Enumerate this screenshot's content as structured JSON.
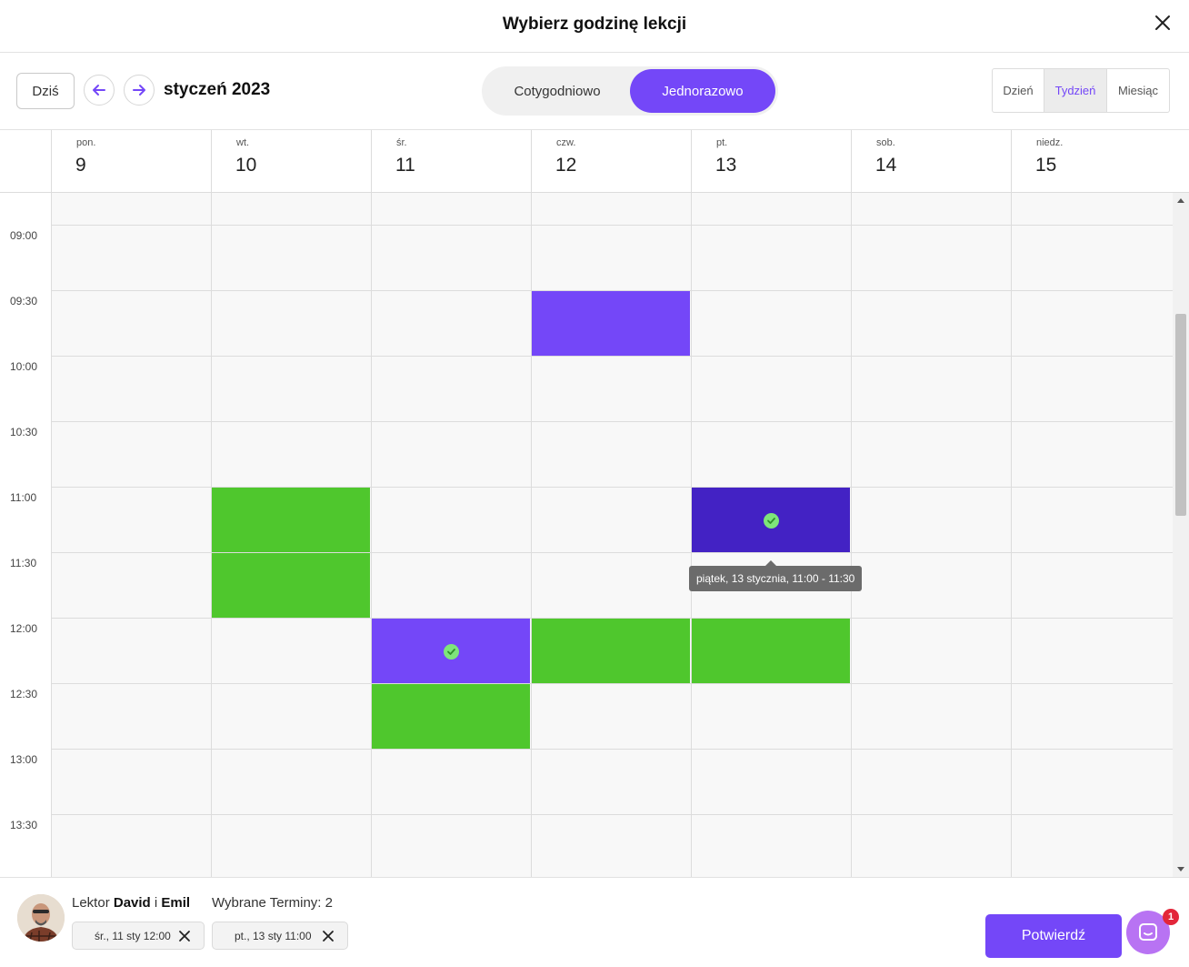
{
  "header": {
    "title": "Wybierz godzinę lekcji",
    "close_icon": "close-icon"
  },
  "toolbar": {
    "today_label": "Dziś",
    "month_label": "styczeń 2023",
    "mode": {
      "weekly": "Cotygodniowo",
      "once": "Jednorazowo",
      "selected": "once"
    },
    "views": {
      "day": "Dzień",
      "week": "Tydzień",
      "month": "Miesiąc",
      "selected": "week"
    }
  },
  "days": [
    {
      "name": "pon.",
      "num": "9"
    },
    {
      "name": "wt.",
      "num": "10"
    },
    {
      "name": "śr.",
      "num": "11"
    },
    {
      "name": "czw.",
      "num": "12"
    },
    {
      "name": "pt.",
      "num": "13"
    },
    {
      "name": "sob.",
      "num": "14"
    },
    {
      "name": "niedz.",
      "num": "15"
    }
  ],
  "times": [
    "09:00",
    "09:30",
    "10:00",
    "10:30",
    "11:00",
    "11:30",
    "12:00",
    "12:30",
    "13:00",
    "13:30"
  ],
  "slots": [
    {
      "day": 3,
      "time": "09:30",
      "state": "booked"
    },
    {
      "day": 1,
      "time": "11:00",
      "state": "available"
    },
    {
      "day": 1,
      "time": "11:30",
      "state": "available"
    },
    {
      "day": 4,
      "time": "11:00",
      "state": "selected-hover"
    },
    {
      "day": 2,
      "time": "12:00",
      "state": "selected"
    },
    {
      "day": 3,
      "time": "12:00",
      "state": "available"
    },
    {
      "day": 4,
      "time": "12:00",
      "state": "available"
    },
    {
      "day": 2,
      "time": "12:30",
      "state": "available"
    }
  ],
  "tooltip": "piątek, 13 stycznia, 11:00 - 11:30",
  "footer": {
    "tutor_prefix": "Lektor",
    "tutor_name_1": "David",
    "tutor_joiner": "i",
    "tutor_name_2": "Emil",
    "selected_count": "Wybrane Terminy: 2",
    "chips": [
      "śr., 11 sty 12:00",
      "pt., 13 sty 11:00"
    ],
    "confirm_label": "Potwierdź",
    "chat_badge": "1"
  },
  "colors": {
    "accent": "#7447f8",
    "available": "#4fc72d",
    "selected_dark": "#4322c4",
    "check": "#7ee57a"
  }
}
